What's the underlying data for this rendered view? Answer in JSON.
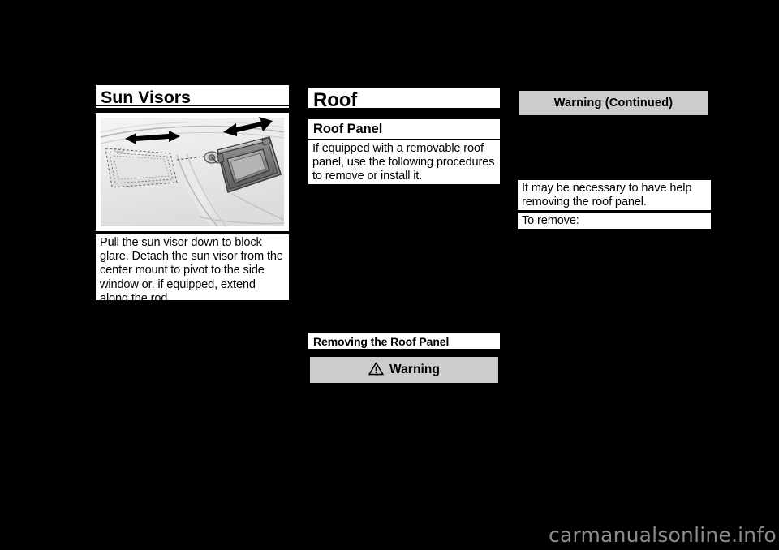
{
  "page": {
    "background_color": "#000000",
    "text_color": "#000000",
    "block_color": "#ffffff",
    "warning_box_color": "#cccccc",
    "watermark": "carmanualsonline.info",
    "watermark_color": "#8c8c8c"
  },
  "column_left": {
    "heading": "Sun Visors",
    "figure": {
      "name": "sun-visor-illustration",
      "description": "Interior headliner view showing a sun visor pivoted to the side window and a dashed outline of the visor in the lowered front position, with double-headed arrows indicating the swing and slide directions"
    },
    "paragraph": "Pull the sun visor down to block glare. Detach the sun visor from the center mount to pivot to the side window or, if equipped, extend along the rod."
  },
  "column_middle": {
    "heading": "Roof",
    "subheading": "Roof Panel",
    "paragraph": "If equipped with a removable roof panel, use the following procedures to remove or install it.",
    "section_heading": "Removing the Roof Panel",
    "warning": {
      "icon": "warning-triangle-icon",
      "label": "Warning"
    }
  },
  "column_right": {
    "warning_continued": {
      "label": "Warning  (Continued)"
    },
    "paragraph": "It may be necessary to have help removing the roof panel.",
    "instruction": "To remove:"
  }
}
